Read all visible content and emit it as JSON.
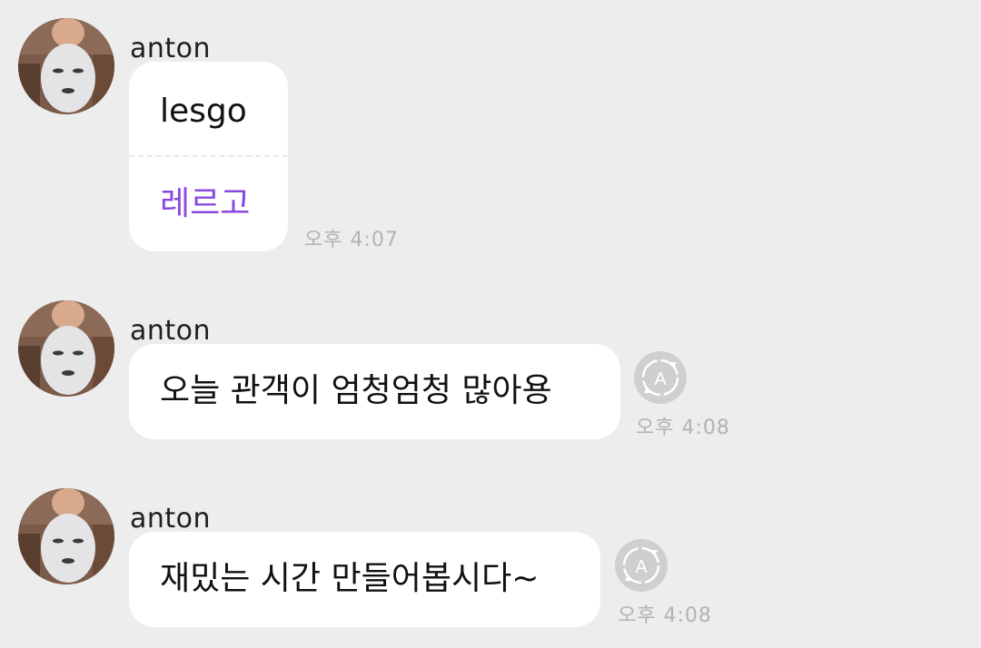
{
  "messages": [
    {
      "sender": "anton",
      "text": "lesgo",
      "translation": "레르고",
      "time": "오후 4:07"
    },
    {
      "sender": "anton",
      "text": "오늘 관객이 엄청엄청 많아용",
      "time": "오후 4:08",
      "translate_icon": "translate-icon"
    },
    {
      "sender": "anton",
      "text": "재밌는 시간 만들어봅시다~",
      "time": "오후 4:08",
      "translate_icon": "translate-icon"
    }
  ],
  "colors": {
    "background": "#ededed",
    "bubble": "#ffffff",
    "translation_text": "#8a48df",
    "timestamp": "#b3b3b3",
    "translate_button": "#cfcfcf"
  }
}
